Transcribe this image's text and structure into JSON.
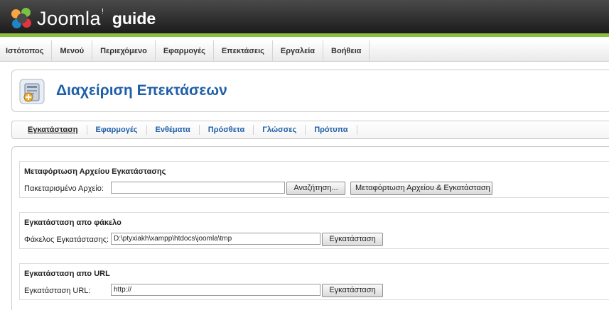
{
  "header": {
    "brand": "Joomla!",
    "brand_text": "Joomla",
    "brand_tm": "!",
    "guide": "guide",
    "accent_color": "#8bbf3f"
  },
  "menubar": {
    "items": [
      {
        "label": "Ιστότοπος"
      },
      {
        "label": "Μενού"
      },
      {
        "label": "Περιεχόμενο"
      },
      {
        "label": "Εφαρμογές"
      },
      {
        "label": "Επεκτάσεις"
      },
      {
        "label": "Εργαλεία"
      },
      {
        "label": "Βοήθεια"
      }
    ]
  },
  "page": {
    "title": "Διαχείριση Επεκτάσεων",
    "title_color": "#1f5fa8",
    "icon": "extension-manager-icon"
  },
  "submenu": {
    "items": [
      {
        "label": "Εγκατάσταση",
        "active": true
      },
      {
        "label": "Εφαρμογές"
      },
      {
        "label": "Ενθέματα"
      },
      {
        "label": "Πρόσθετα"
      },
      {
        "label": "Γλώσσες"
      },
      {
        "label": "Πρότυπα"
      }
    ]
  },
  "upload": {
    "title": "Μεταφόρτωση Αρχείου Εγκατάστασης",
    "label": "Πακεταρισμένο Αρχείο:",
    "value": "",
    "browse_label": "Αναζήτηση...",
    "submit_label": "Μεταφόρτωση Αρχείου & Εγκατάσταση"
  },
  "directory": {
    "title": "Εγκατάσταση απο φάκελο",
    "label": "Φάκελος Εγκατάστασης:",
    "value": "D:\\ptyxiakh\\xampp\\htdocs\\joomla\\tmp",
    "submit_label": "Εγκατάσταση"
  },
  "url": {
    "title": "Εγκατάσταση απο URL",
    "label": "Εγκατάσταση URL:",
    "value": "http://",
    "submit_label": "Εγκατάσταση"
  }
}
